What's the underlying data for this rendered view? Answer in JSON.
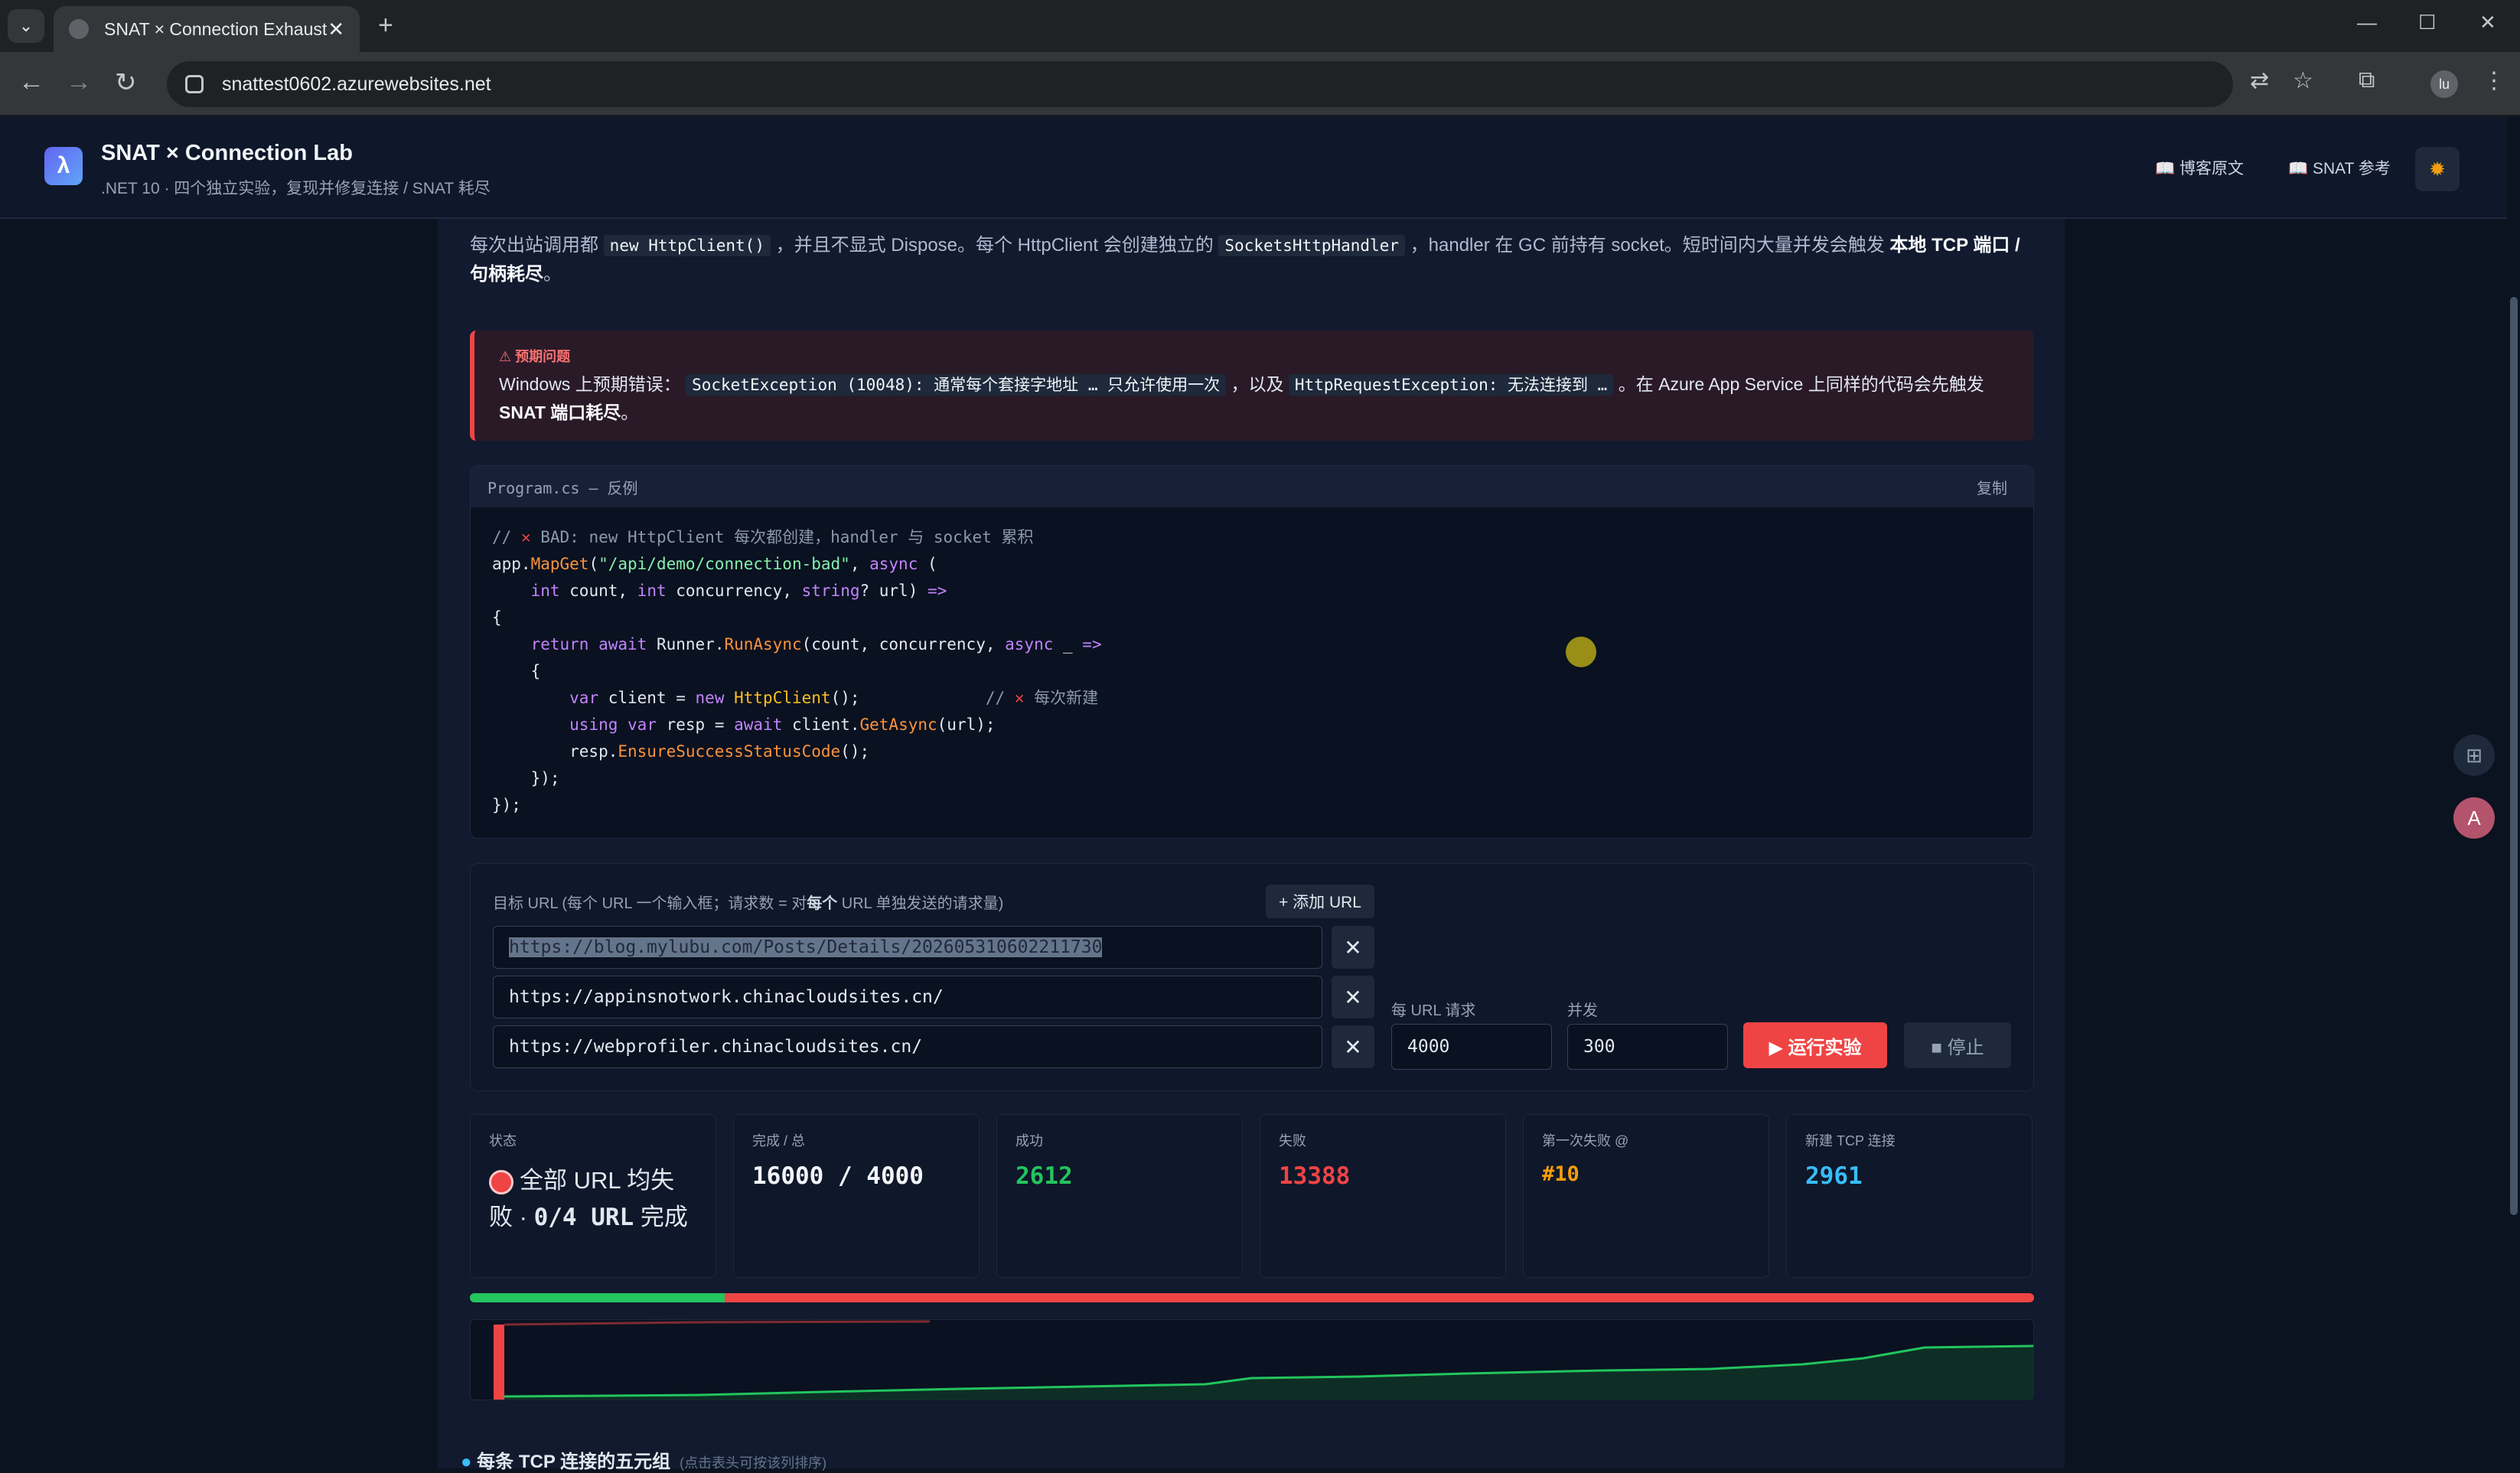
{
  "browser": {
    "tab_title": "SNAT × Connection Exhaustion",
    "url": "snattest0602.azurewebsites.net",
    "profile_initial": "lu"
  },
  "header": {
    "logo_glyph": "λ",
    "title": "SNAT × Connection Lab",
    "subtitle": ".NET 10 · 四个独立实验，复现并修复连接 / SNAT 耗尽",
    "link_blog": "📖 博客原文",
    "link_snat": "📖 SNAT 参考"
  },
  "description": {
    "p1": "每次出站调用都",
    "c1": "new HttpClient()",
    "p2": "，并且不显式 Dispose。每个 HttpClient 会创建独立的",
    "c2": "SocketsHttpHandler",
    "p3": "，handler 在 GC 前持有 socket。短时间内大量并发会触发",
    "b1": "本地 TCP 端口 / 句柄耗尽",
    "p4": "。"
  },
  "warning": {
    "label": "⚠ 预期问题",
    "p1": "Windows 上预期错误：",
    "c1": "SocketException (10048): 通常每个套接字地址 … 只允许使用一次",
    "p2": "，以及",
    "c2": "HttpRequestException: 无法连接到 …",
    "p3": "。在 Azure App Service 上同样的代码会先触发",
    "b1": "SNAT 端口耗尽",
    "p4": "。"
  },
  "code": {
    "filename": "Program.cs — 反例",
    "copy_label": "复制",
    "l1_comment": "// ",
    "l1_text": " BAD: new HttpClient 每次都创建，handler 与 socket 累积",
    "l2_a": "app.",
    "l2_fn": "MapGet",
    "l2_b": "(",
    "l2_str": "\"/api/demo/connection-bad\"",
    "l2_c": ", ",
    "l2_kw": "async",
    "l2_d": " (",
    "l3_a": "    ",
    "l3_kw1": "int",
    "l3_b": " count, ",
    "l3_kw2": "int",
    "l3_c": " concurrency, ",
    "l3_kw3": "string",
    "l3_d": "? url) ",
    "l3_arrow": "=>",
    "l4": "{",
    "l5_a": "    ",
    "l5_kw1": "return",
    "l5_b": " ",
    "l5_kw2": "await",
    "l5_c": " Runner.",
    "l5_fn": "RunAsync",
    "l5_d": "(count, concurrency, ",
    "l5_kw3": "async",
    "l5_e": " _ ",
    "l5_arrow": "=>",
    "l6": "    {",
    "l7_a": "        ",
    "l7_kw1": "var",
    "l7_b": " client = ",
    "l7_kw2": "new",
    "l7_c": " ",
    "l7_ty": "HttpClient",
    "l7_d": "();             ",
    "l7_cm": "// ",
    "l7_cm2": " 每次新建",
    "l8_a": "        ",
    "l8_kw1": "using",
    "l8_b": " ",
    "l8_kw2": "var",
    "l8_c": " resp = ",
    "l8_kw3": "await",
    "l8_d": " client.",
    "l8_fn": "GetAsync",
    "l8_e": "(url);",
    "l9_a": "        resp.",
    "l9_fn": "EnsureSuccessStatusCode",
    "l9_b": "();",
    "l10": "    });",
    "l11": "});"
  },
  "form": {
    "label_a": "目标 URL",
    "label_b": " (每个 URL 一个输入框；请求数 = 对",
    "label_bold": "每个",
    "label_c": " URL 单独发送的请求量)",
    "add_url": "+ 添加 URL",
    "urls": [
      "https://blog.mylubu.com/Posts/Details/202605310602211730",
      "https://appinsnotwork.chinacloudsites.cn/",
      "https://webprofiler.chinacloudsites.cn/"
    ],
    "remove_glyph": "✕",
    "per_url_label": "每 URL 请求",
    "per_url_value": "4000",
    "concurrency_label": "并发",
    "concurrency_value": "300",
    "run_label": "▶ 运行实验",
    "stop_label": "■ 停止"
  },
  "stats": {
    "status_label": "状态",
    "status_a": "全部 URL 均失败 · ",
    "status_b": "0/4 URL",
    "status_c": " 完成",
    "done_label": "完成 / 总",
    "done_value": "16000 / 4000",
    "success_label": "成功",
    "success_value": "2612",
    "fail_label": "失败",
    "fail_value": "13388",
    "first_fail_label": "第一次失败 @",
    "first_fail_value": "#10",
    "tcp_label": "新建 TCP 连接",
    "tcp_value": "2961"
  },
  "progress": {
    "success_fraction": 0.163
  },
  "section": {
    "title": "每条 TCP 连接的五元组",
    "hint": "(点击表头可按该列排序)"
  },
  "colors": {
    "accent_red": "#ef4444",
    "success_green": "#22c55e",
    "warn_orange": "#f59e0b",
    "info_blue": "#38bdf8"
  }
}
